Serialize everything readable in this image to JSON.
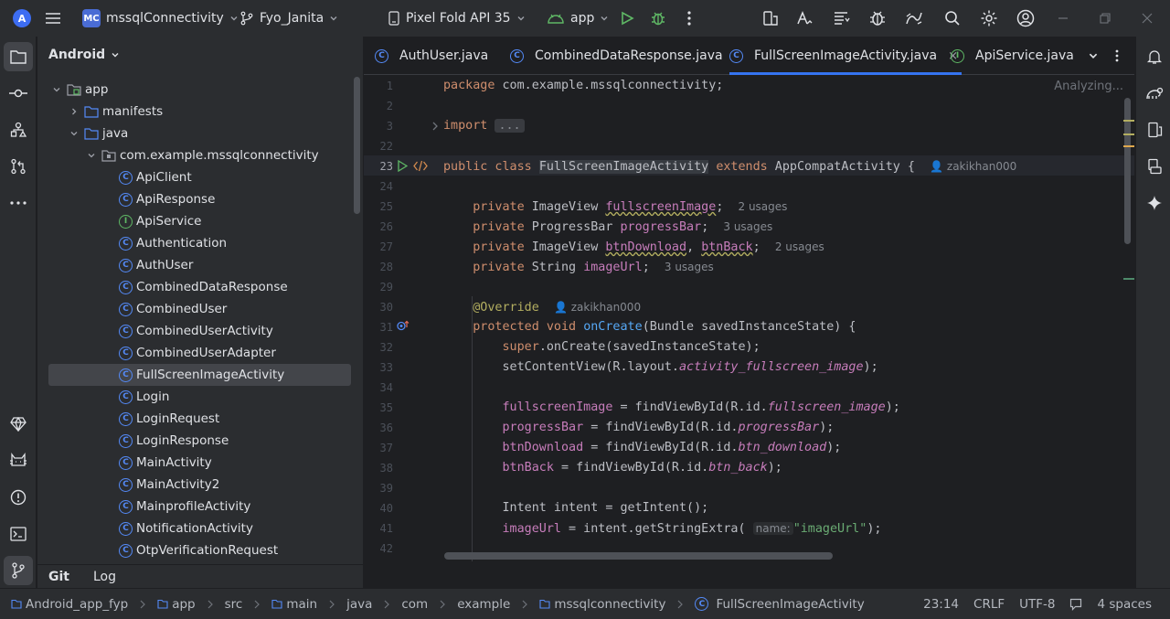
{
  "titlebar": {
    "logo": "A",
    "project_badge": "MC",
    "project_name": "mssqlConnectivity",
    "branch": "Fyo_Janita",
    "device": "Pixel Fold API 35",
    "run_config": "app"
  },
  "sidebar": {
    "view": "Android"
  },
  "tree": [
    {
      "label": "app",
      "depth": 0,
      "kind": "module",
      "expanded": true
    },
    {
      "label": "manifests",
      "depth": 1,
      "kind": "folder",
      "expanded": false
    },
    {
      "label": "java",
      "depth": 1,
      "kind": "folder",
      "expanded": true
    },
    {
      "label": "com.example.mssqlconnectivity",
      "depth": 2,
      "kind": "package",
      "expanded": true
    },
    {
      "label": "ApiClient",
      "depth": 3,
      "kind": "class"
    },
    {
      "label": "ApiResponse",
      "depth": 3,
      "kind": "class"
    },
    {
      "label": "ApiService",
      "depth": 3,
      "kind": "interface"
    },
    {
      "label": "Authentication",
      "depth": 3,
      "kind": "class"
    },
    {
      "label": "AuthUser",
      "depth": 3,
      "kind": "class"
    },
    {
      "label": "CombinedDataResponse",
      "depth": 3,
      "kind": "class"
    },
    {
      "label": "CombinedUser",
      "depth": 3,
      "kind": "class"
    },
    {
      "label": "CombinedUserActivity",
      "depth": 3,
      "kind": "class"
    },
    {
      "label": "CombinedUserAdapter",
      "depth": 3,
      "kind": "class"
    },
    {
      "label": "FullScreenImageActivity",
      "depth": 3,
      "kind": "class",
      "selected": true
    },
    {
      "label": "Login",
      "depth": 3,
      "kind": "class"
    },
    {
      "label": "LoginRequest",
      "depth": 3,
      "kind": "class"
    },
    {
      "label": "LoginResponse",
      "depth": 3,
      "kind": "class"
    },
    {
      "label": "MainActivity",
      "depth": 3,
      "kind": "class"
    },
    {
      "label": "MainActivity2",
      "depth": 3,
      "kind": "class"
    },
    {
      "label": "MainprofileActivity",
      "depth": 3,
      "kind": "class"
    },
    {
      "label": "NotificationActivity",
      "depth": 3,
      "kind": "class"
    },
    {
      "label": "OtpVerificationRequest",
      "depth": 3,
      "kind": "class"
    }
  ],
  "git_tabs": [
    "Git",
    "Log"
  ],
  "tabs": [
    {
      "label": "AuthUser.java",
      "kind": "class"
    },
    {
      "label": "CombinedDataResponse.java",
      "kind": "class"
    },
    {
      "label": "FullScreenImageActivity.java",
      "kind": "class",
      "active": true,
      "close": "×"
    },
    {
      "label": "ApiService.java",
      "kind": "interface"
    }
  ],
  "editor": {
    "status": "Analyzing...",
    "fold_placeholder": "...",
    "line_numbers": [
      "1",
      "2",
      "3",
      "22",
      "23",
      "24",
      "25",
      "26",
      "27",
      "28",
      "29",
      "30",
      "31",
      "32",
      "33",
      "34",
      "35",
      "36",
      "37",
      "38",
      "39",
      "40",
      "41",
      "42"
    ],
    "author": "zakikhan000",
    "usages": {
      "two": "2 usages",
      "three": "3 usages"
    },
    "param_hint": "name:"
  },
  "statusbar": {
    "breadcrumbs": [
      "Android_app_fyp",
      "app",
      "src",
      "main",
      "java",
      "com",
      "example",
      "mssqlconnectivity",
      "FullScreenImageActivity"
    ],
    "position": "23:14",
    "line_sep": "CRLF",
    "encoding": "UTF-8",
    "indent": "4 spaces"
  }
}
